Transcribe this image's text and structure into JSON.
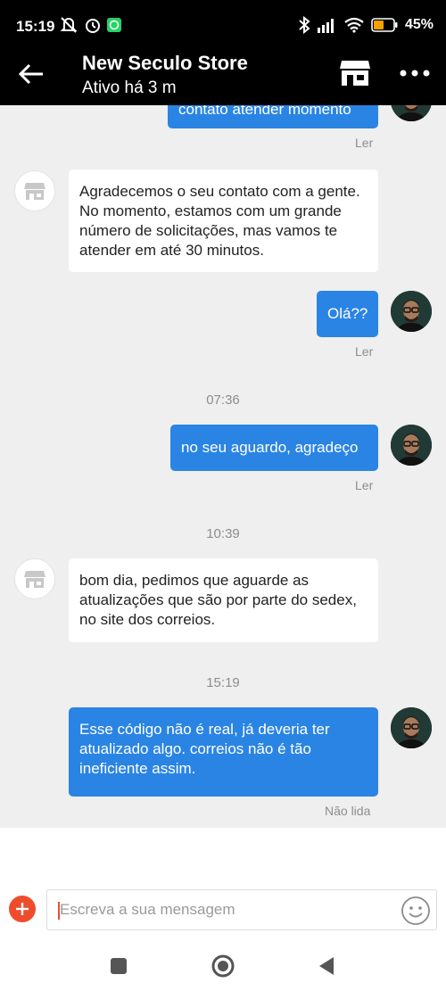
{
  "status_bar": {
    "time": "15:19",
    "battery": "45%",
    "icons": [
      "muted-notifications-icon",
      "alarm-icon",
      "whatsapp-icon",
      "bluetooth-icon",
      "signal-icon",
      "wifi-icon",
      "battery-icon"
    ]
  },
  "header": {
    "title": "New Seculo Store",
    "subtitle": "Ativo há 3 m",
    "icons": [
      "back-arrow-icon",
      "store-icon",
      "more-icon"
    ]
  },
  "messages": [
    {
      "id": "m0",
      "direction": "out",
      "text": "contato atender momento",
      "status": "Ler"
    },
    {
      "id": "m1",
      "direction": "in",
      "text": "Agradecemos o seu contato com a gente. No momento, estamos com um grande número de solicitações, mas vamos te atender em até 30 minutos."
    },
    {
      "id": "m2",
      "direction": "out",
      "text": "Olá??",
      "status": "Ler"
    },
    {
      "id": "sep1",
      "time": "07:36"
    },
    {
      "id": "m3",
      "direction": "out",
      "text": "no seu aguardo, agradeço",
      "status": "Ler"
    },
    {
      "id": "sep2",
      "time": "10:39"
    },
    {
      "id": "m4",
      "direction": "in",
      "text": "bom dia, pedimos que aguarde as atualizações que são por parte do sedex, no site dos correios."
    },
    {
      "id": "sep3",
      "time": "15:19"
    },
    {
      "id": "m5",
      "direction": "out",
      "text": "Esse código não é real, já deveria ter atualizado algo. correios não é tão ineficiente assim.",
      "status": "Não lida"
    }
  ],
  "composer": {
    "placeholder": "Escreva a sua mensagem"
  },
  "colors": {
    "accent": "#ee4d2d",
    "bubble_out": "#2a84e4",
    "chat_bg": "#efefef"
  }
}
